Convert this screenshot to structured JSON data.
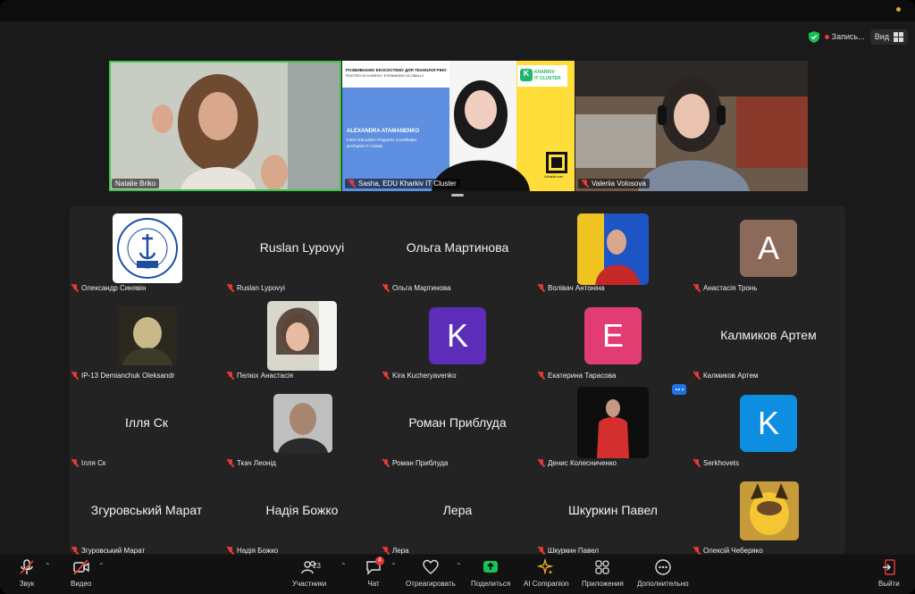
{
  "topbar": {
    "recording_label": "Запись...",
    "view_label": "Вид"
  },
  "strip": [
    {
      "name": "Natalie Briko",
      "muted": false
    },
    {
      "name": "Sasha, EDU Kharkiv IT Cluster",
      "muted": true,
      "slide": {
        "headline": "РОЗВИВАЄМО ЕКОСИСТЕМУ ДЛЯ ТЕХНОЛОГІЧНО",
        "sub": "ROOTED IN KHARKIV, EXPANDING GLOBALLY",
        "person": "ALEXANDRA ATAMANENKO",
        "role1": "Intern Education Programs Coordinator",
        "role2": "at Kharkiv IT Cluster",
        "logo1": "KHARKIV",
        "logo2": "IT CLUSTER",
        "logo_letter": "K",
        "site": "it-kharkiv.com"
      }
    },
    {
      "name": "Valeriia Volosova",
      "muted": true
    }
  ],
  "participants": [
    {
      "label": "Олександр Синявін",
      "type": "photo"
    },
    {
      "label": "Ruslan Lypovyi",
      "center": "Ruslan Lypovyi",
      "type": "name"
    },
    {
      "label": "Ольга Мартинова",
      "center": "Ольга Мартинова",
      "type": "name"
    },
    {
      "label": "Волівач Антоніна",
      "type": "photo"
    },
    {
      "label": "Анастасія Тронь",
      "letter": "A",
      "color": "#8c6a5a",
      "type": "letter"
    },
    {
      "label": "IP-13 Demianchuk Oleksandr",
      "type": "photo"
    },
    {
      "label": "Пелюх Анастасія",
      "type": "photo"
    },
    {
      "label": "Kira Kucheryavenko",
      "letter": "K",
      "color": "#5b2db8",
      "type": "letter"
    },
    {
      "label": "Екатерина Тарасова",
      "letter": "E",
      "color": "#e23d73",
      "type": "letter"
    },
    {
      "label": "Калмиков Артем",
      "center": "Калмиков Артем",
      "type": "name"
    },
    {
      "label": "Ілля Ск",
      "center": "Ілля Ск",
      "type": "name"
    },
    {
      "label": "Ткач Леонід",
      "type": "photo"
    },
    {
      "label": "Роман Приблуда",
      "center": "Роман Приблуда",
      "type": "name"
    },
    {
      "label": "Денис Колесниченко",
      "type": "photo"
    },
    {
      "label": "Serkhovets",
      "letter": "K",
      "color": "#0e8ee0",
      "type": "letter"
    },
    {
      "label": "Згуровський Марат",
      "center": "Згуровський Марат",
      "type": "name"
    },
    {
      "label": "Надія Божко",
      "center": "Надія Божко",
      "type": "name"
    },
    {
      "label": "Лера",
      "center": "Лера",
      "type": "name"
    },
    {
      "label": "Шкуркин Павел",
      "center": "Шкуркин Павел",
      "type": "name"
    },
    {
      "label": "Олексій Чеберяко",
      "type": "photo"
    }
  ],
  "logo_text": {
    "arc": "НУК імені адмірала Макарова",
    "arc2": "Фаховий коледж",
    "abbr": "ВСП"
  },
  "toolbar": {
    "audio": "Звук",
    "video": "Видео",
    "participants": "Участники",
    "participants_count": "23",
    "chat": "Чат",
    "chat_badge": "4",
    "react": "Отреагировать",
    "share": "Поделиться",
    "companion": "AI Companion",
    "apps": "Приложения",
    "more": "Дополнительно",
    "leave": "Выйти"
  },
  "colors": {
    "accent_green": "#3ec64a",
    "share_green": "#19c15a",
    "muted_red": "#e53935"
  }
}
